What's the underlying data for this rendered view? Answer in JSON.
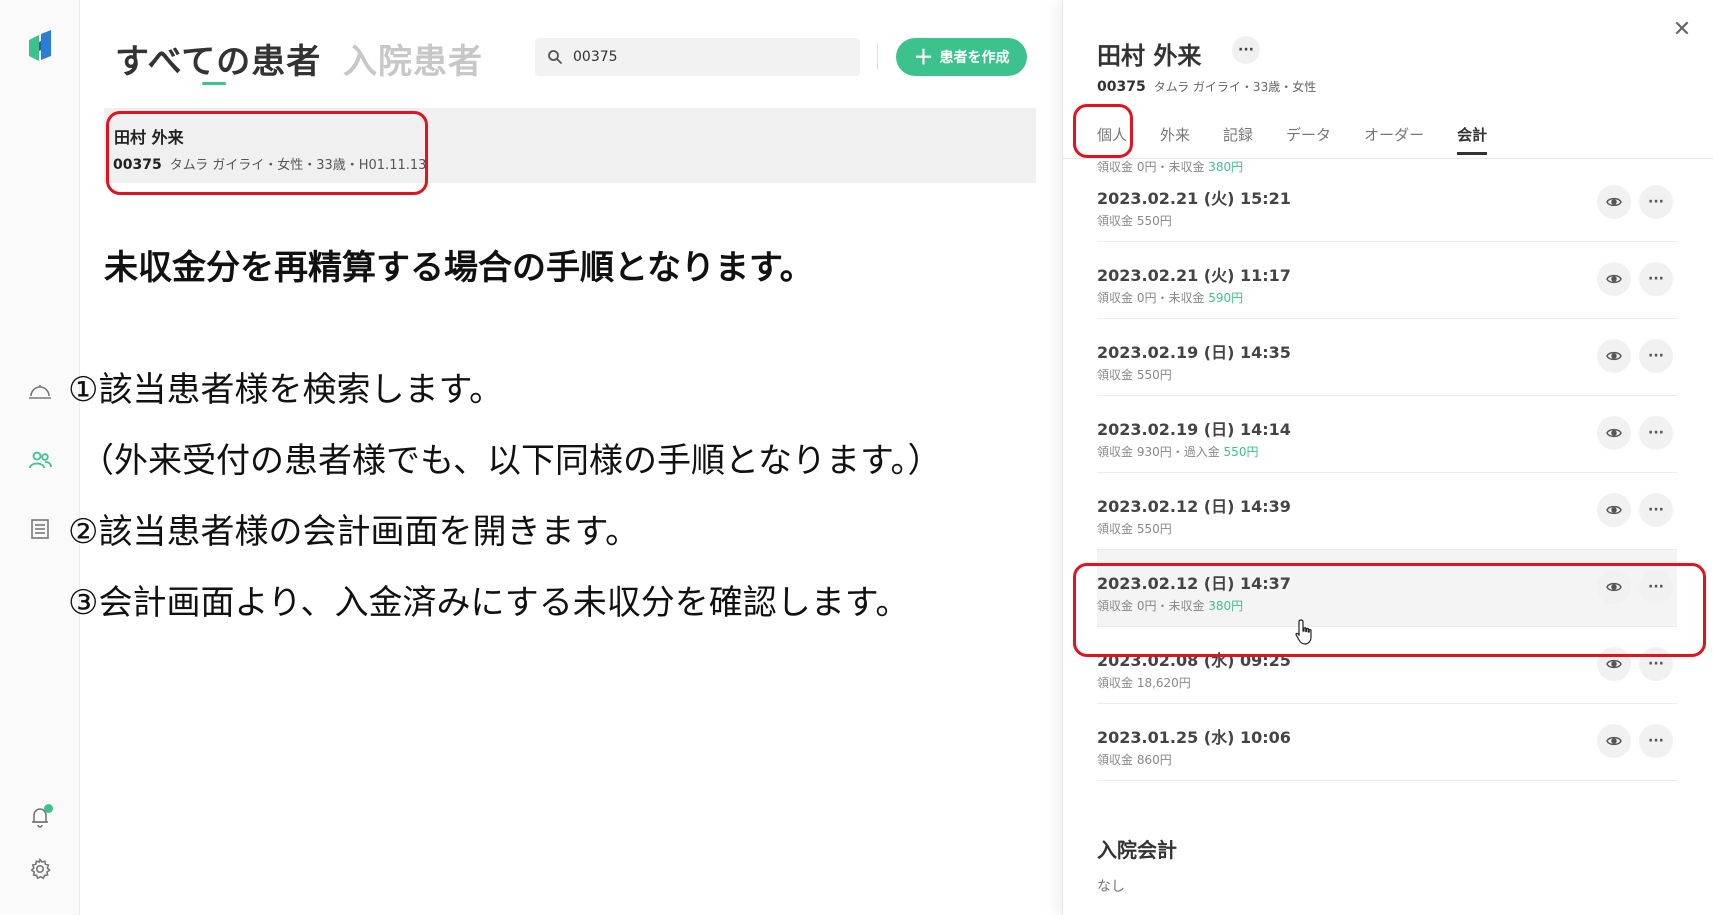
{
  "sidebar": {
    "icons": [
      "logo",
      "reception-bell-icon",
      "patients-icon",
      "records-icon",
      "notification-bell-icon",
      "gear-icon"
    ]
  },
  "main": {
    "tabs": [
      "すべての患者",
      "入院患者"
    ],
    "search": {
      "value": "00375"
    },
    "create_button": "患者を作成",
    "patient": {
      "name": "田村 外来",
      "id": "00375",
      "details": "タムラ ガイライ・女性・33歳・H01.11.13"
    },
    "heading": "未収金分を再精算する場合の手順となります。",
    "steps": [
      "①該当患者様を検索します。",
      "（外来受付の患者様でも、以下同様の手順となります。）",
      "②該当患者様の会計画面を開きます。",
      "③会計画面より、入金済みにする未収分を確認します。"
    ]
  },
  "panel": {
    "name": "田村 外来",
    "id": "00375",
    "details": "タムラ ガイライ・33歳・女性",
    "tabs": [
      "個人",
      "外来",
      "記録",
      "データ",
      "オーダー",
      "会計"
    ],
    "active_tab": "会計",
    "partial_top": {
      "text": "領収金 0円・未収金 ",
      "green": "380円"
    },
    "records": [
      {
        "date": "2023.02.21 (火) 15:21",
        "sub": "領収金 550円",
        "green": ""
      },
      {
        "date": "2023.02.21 (火) 11:17",
        "sub": "領収金 0円・未収金 ",
        "green": "590円"
      },
      {
        "date": "2023.02.19 (日) 14:35",
        "sub": "領収金 550円",
        "green": ""
      },
      {
        "date": "2023.02.19 (日) 14:14",
        "sub": "領収金 930円・過入金 ",
        "green": "550円"
      },
      {
        "date": "2023.02.12 (日) 14:39",
        "sub": "領収金 550円",
        "green": ""
      },
      {
        "date": "2023.02.12 (日) 14:37",
        "sub": "領収金 0円・未収金 ",
        "green": "380円"
      },
      {
        "date": "2023.02.08 (水) 09:25",
        "sub": "領収金 18,620円",
        "green": ""
      },
      {
        "date": "2023.01.25 (水) 10:06",
        "sub": "領収金 860円",
        "green": ""
      }
    ],
    "inpatient_title": "入院会計",
    "inpatient_none": "なし"
  },
  "colors": {
    "accent": "#3cc28c",
    "highlight_box": "#e0131f"
  }
}
